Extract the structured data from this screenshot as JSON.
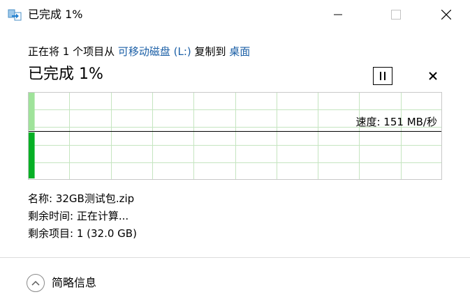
{
  "window": {
    "title": "已完成 1%"
  },
  "copy_info": {
    "prefix": "正在将 1 个项目从 ",
    "source": "可移动磁盘 (L:)",
    "middle": " 复制到 ",
    "destination": "桌面"
  },
  "progress": {
    "title": "已完成 1%",
    "percent": 1,
    "speed_label": "速度: 151 MB/秒"
  },
  "details": {
    "name": "名称:  32GB测试包.zip",
    "time_remaining": "剩余时间:  正在计算...",
    "items_remaining": "剩余项目:  1 (32.0 GB)"
  },
  "footer": {
    "toggle_label": "简略信息"
  },
  "colors": {
    "link": "#1b5fa6",
    "progress_fill": "#06b025",
    "progress_fill_light": "#9fe39a",
    "grid": "#c5e5c0",
    "chart_border": "#c8c8c8"
  },
  "icons": {
    "app": "copy-arrow-icon",
    "minimize": "minimize-icon",
    "maximize": "maximize-icon",
    "close": "close-icon",
    "pause": "pause-icon",
    "cancel": "cancel-icon",
    "toggle": "chevron-up-icon"
  }
}
